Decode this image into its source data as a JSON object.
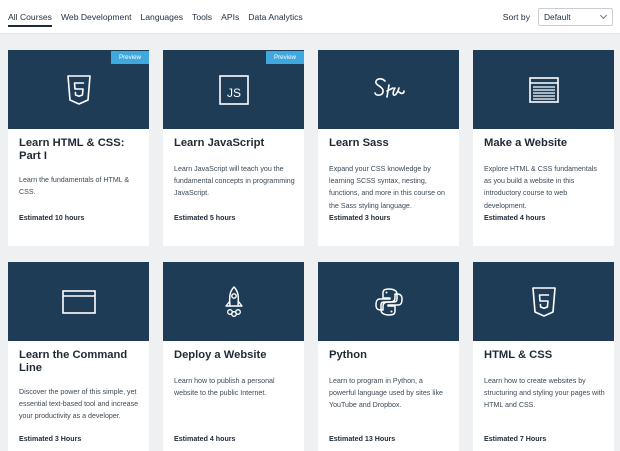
{
  "nav": {
    "tabs": [
      {
        "label": "All Courses",
        "active": true
      },
      {
        "label": "Web Development",
        "active": false
      },
      {
        "label": "Languages",
        "active": false
      },
      {
        "label": "Tools",
        "active": false
      },
      {
        "label": "APIs",
        "active": false
      },
      {
        "label": "Data Analytics",
        "active": false
      }
    ],
    "sort_label": "Sort by",
    "sort_value": "Default"
  },
  "courses": [
    {
      "title": "Learn HTML & CSS: Part I",
      "description": "Learn the fundamentals of HTML & CSS.",
      "hours": "Estimated 10 hours",
      "badge": "Preview",
      "icon": "html5-icon"
    },
    {
      "title": "Learn JavaScript",
      "description": "Learn JavaScript will teach you the fundamental concepts in programming JavaScript.",
      "hours": "Estimated 5 hours",
      "badge": "Preview",
      "icon": "js-icon"
    },
    {
      "title": "Learn Sass",
      "description": "Expand your CSS knowledge by learning SCSS syntax, nesting, functions, and more in this course on the Sass styling language.",
      "hours": "Estimated 3 hours",
      "badge": "",
      "icon": "sass-icon"
    },
    {
      "title": "Make a Website",
      "description": "Explore HTML & CSS fundamentals as you build a website in this introductory course to web development.",
      "hours": "Estimated 4 hours",
      "badge": "",
      "icon": "website-layout-icon"
    },
    {
      "title": "Learn the Command Line",
      "description": "Discover the power of this simple, yet essential text-based tool and increase your productivity as a developer.",
      "hours": "Estimated 3 Hours",
      "badge": "",
      "icon": "terminal-window-icon"
    },
    {
      "title": "Deploy a Website",
      "description": "Learn how to publish a personal website to the public Internet.",
      "hours": "Estimated 4 hours",
      "badge": "",
      "icon": "rocket-icon"
    },
    {
      "title": "Python",
      "description": "Learn to program in Python, a powerful language used by sites like YouTube and Dropbox.",
      "hours": "Estimated 13 Hours",
      "badge": "",
      "icon": "python-icon"
    },
    {
      "title": "HTML & CSS",
      "description": "Learn how to create websites by structuring and styling your pages with HTML and CSS.",
      "hours": "Estimated 7 Hours",
      "badge": "",
      "icon": "html5-icon"
    }
  ],
  "colors": {
    "banner": "#1f3c56",
    "preview_badge": "#3fa8de",
    "page_bg": "#eef0f2"
  }
}
